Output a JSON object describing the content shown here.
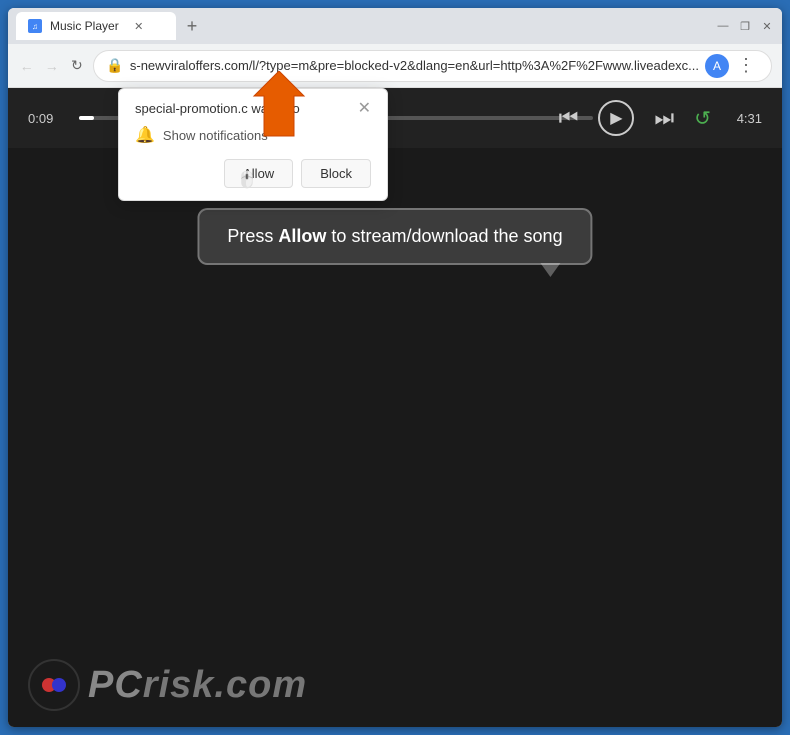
{
  "browser": {
    "tab": {
      "title": "Music Player",
      "favicon": "♫"
    },
    "new_tab_label": "+",
    "window_controls": {
      "minimize": "—",
      "maximize": "❐",
      "close": "✕"
    },
    "nav": {
      "back": "←",
      "forward": "→",
      "refresh": "↻"
    },
    "url": "s-newviraloffers.com/l/?type=m&pre=blocked-v2&dlang=en&url=http%3A%2F%2Fwww.liveadexc...",
    "profile_initial": "A",
    "menu": "⋮"
  },
  "notification": {
    "site": "special-promotion.c",
    "wants_to": "wants to",
    "body": "Show notifications",
    "allow_label": "Allow",
    "block_label": "Block",
    "close": "✕"
  },
  "player": {
    "time_current": "0:09",
    "time_total": "4:31",
    "progress_percent": 3
  },
  "overlay": {
    "message_prefix": "Press ",
    "message_bold": "Allow",
    "message_suffix": " to stream/download the song"
  },
  "watermark": {
    "text_normal": "risk.com",
    "text_accent": "PC",
    "logo_dots": [
      "#e44",
      "#44e"
    ]
  }
}
